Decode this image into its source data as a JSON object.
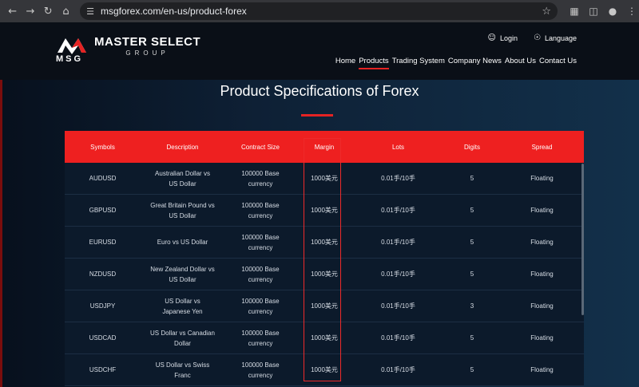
{
  "browser": {
    "url": "msgforex.com/en-us/product-forex",
    "icons": [
      "back-icon",
      "forward-icon",
      "reload-icon",
      "home-icon",
      "site-info-icon",
      "bookmark-star-icon",
      "extensions-icon",
      "sidebar-icon",
      "profile-icon",
      "menu-icon"
    ]
  },
  "brand": {
    "title": "MASTER SELECT",
    "subtitle": "GROUP",
    "msg": "MSG",
    "accent": "#e52323"
  },
  "top_links": {
    "login": "Login",
    "language": "Language"
  },
  "nav": [
    "Home",
    "Products",
    "Trading System",
    "Company News",
    "About Us",
    "Contact Us"
  ],
  "nav_active": "Products",
  "page": {
    "title": "Product Specifications of Forex"
  },
  "table": {
    "headers": [
      "Symbols",
      "Description",
      "Contract Size",
      "Margin",
      "Lots",
      "Digits",
      "Spread"
    ],
    "rows": [
      [
        "AUDUSD",
        "Australian Dollar vs US Dollar",
        "100000 Base currency",
        "1000美元",
        "0.01手/10手",
        "5",
        "Floating"
      ],
      [
        "GBPUSD",
        "Great Britain Pound vs US Dollar",
        "100000 Base currency",
        "1000美元",
        "0.01手/10手",
        "5",
        "Floating"
      ],
      [
        "EURUSD",
        "Euro vs US Dollar",
        "100000 Base currency",
        "1000美元",
        "0.01手/10手",
        "5",
        "Floating"
      ],
      [
        "NZDUSD",
        "New Zealand Dollar vs US Dollar",
        "100000 Base currency",
        "1000美元",
        "0.01手/10手",
        "5",
        "Floating"
      ],
      [
        "USDJPY",
        "US Dollar vs Japanese Yen",
        "100000 Base currency",
        "1000美元",
        "0.01手/10手",
        "3",
        "Floating"
      ],
      [
        "USDCAD",
        "US Dollar vs Canadian Dollar",
        "100000 Base currency",
        "1000美元",
        "0.01手/10手",
        "5",
        "Floating"
      ],
      [
        "USDCHF",
        "US Dollar vs Swiss Franc",
        "100000 Base currency",
        "1000美元",
        "0.01手/10手",
        "5",
        "Floating"
      ]
    ]
  }
}
